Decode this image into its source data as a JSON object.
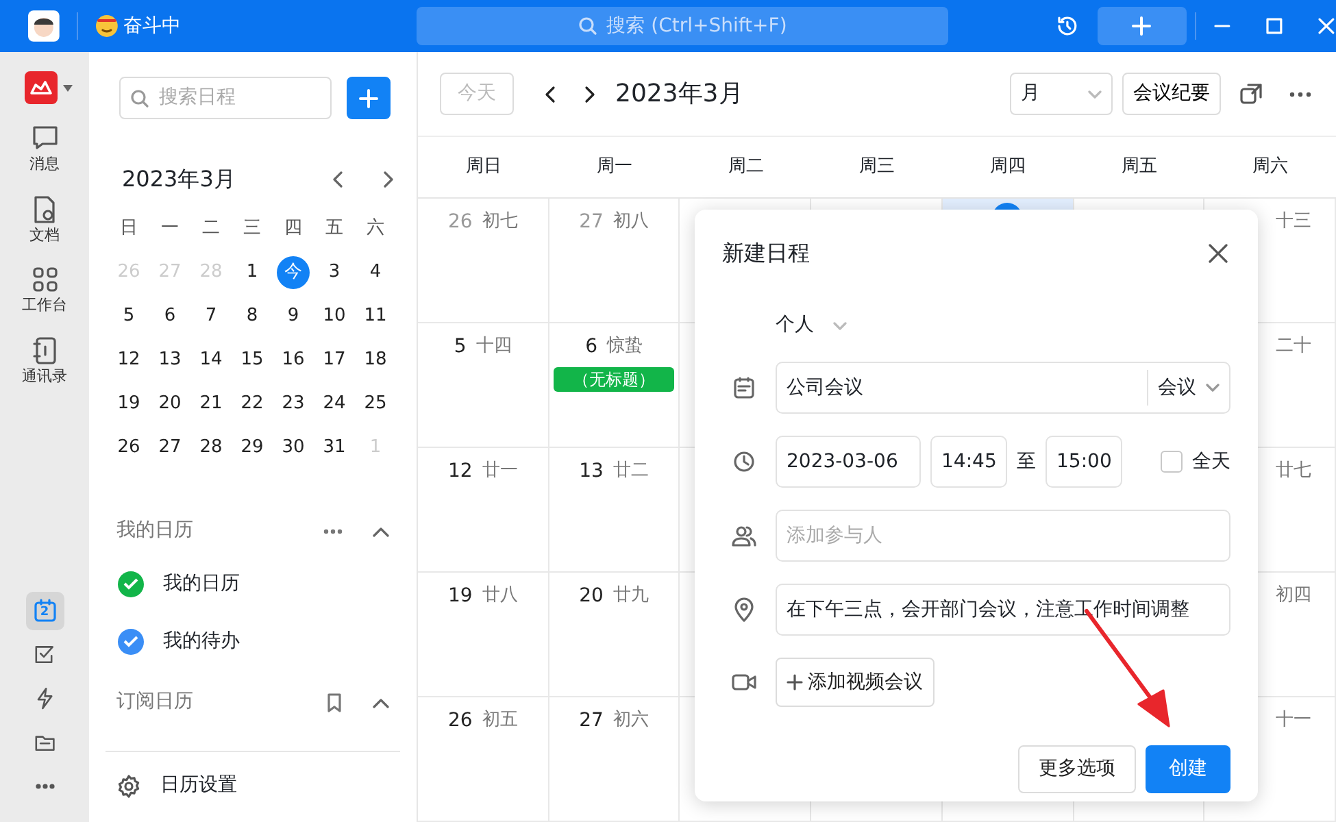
{
  "title_bar": {
    "status": "奋斗中",
    "search_placeholder": "搜索 (Ctrl+Shift+F)"
  },
  "rail": {
    "items": [
      {
        "kind": "chat",
        "label": "消息"
      },
      {
        "kind": "doc",
        "label": "文档"
      },
      {
        "kind": "grid",
        "label": "工作台"
      },
      {
        "kind": "contacts",
        "label": "通讯录"
      }
    ],
    "bottom": [
      {
        "kind": "calendar",
        "badge": "2",
        "selected": true
      },
      {
        "kind": "task",
        "selected": false
      },
      {
        "kind": "bolt",
        "selected": false
      },
      {
        "kind": "folder",
        "selected": false
      },
      {
        "kind": "more",
        "selected": false
      }
    ]
  },
  "sidebar": {
    "search_placeholder": "搜索日程",
    "mini_calendar": {
      "title": "2023年3月",
      "weekdays": [
        "日",
        "一",
        "二",
        "三",
        "四",
        "五",
        "六"
      ],
      "days": [
        {
          "label": "26",
          "outside": true,
          "today": false
        },
        {
          "label": "27",
          "outside": true,
          "today": false
        },
        {
          "label": "28",
          "outside": true,
          "today": false
        },
        {
          "label": "1",
          "outside": false,
          "today": false
        },
        {
          "label": "今",
          "outside": false,
          "today": true
        },
        {
          "label": "3",
          "outside": false,
          "today": false
        },
        {
          "label": "4",
          "outside": false,
          "today": false
        },
        {
          "label": "5",
          "outside": false,
          "today": false
        },
        {
          "label": "6",
          "outside": false,
          "today": false
        },
        {
          "label": "7",
          "outside": false,
          "today": false
        },
        {
          "label": "8",
          "outside": false,
          "today": false
        },
        {
          "label": "9",
          "outside": false,
          "today": false
        },
        {
          "label": "10",
          "outside": false,
          "today": false
        },
        {
          "label": "11",
          "outside": false,
          "today": false
        },
        {
          "label": "12",
          "outside": false,
          "today": false
        },
        {
          "label": "13",
          "outside": false,
          "today": false
        },
        {
          "label": "14",
          "outside": false,
          "today": false
        },
        {
          "label": "15",
          "outside": false,
          "today": false
        },
        {
          "label": "16",
          "outside": false,
          "today": false
        },
        {
          "label": "17",
          "outside": false,
          "today": false
        },
        {
          "label": "18",
          "outside": false,
          "today": false
        },
        {
          "label": "19",
          "outside": false,
          "today": false
        },
        {
          "label": "20",
          "outside": false,
          "today": false
        },
        {
          "label": "21",
          "outside": false,
          "today": false
        },
        {
          "label": "22",
          "outside": false,
          "today": false
        },
        {
          "label": "23",
          "outside": false,
          "today": false
        },
        {
          "label": "24",
          "outside": false,
          "today": false
        },
        {
          "label": "25",
          "outside": false,
          "today": false
        },
        {
          "label": "26",
          "outside": false,
          "today": false
        },
        {
          "label": "27",
          "outside": false,
          "today": false
        },
        {
          "label": "28",
          "outside": false,
          "today": false
        },
        {
          "label": "29",
          "outside": false,
          "today": false
        },
        {
          "label": "30",
          "outside": false,
          "today": false
        },
        {
          "label": "31",
          "outside": false,
          "today": false
        },
        {
          "label": "1",
          "outside": true,
          "today": false
        }
      ]
    },
    "sections": [
      {
        "title": "我的日历",
        "kind": "mine",
        "expanded": true,
        "items": [
          {
            "label": "我的日历",
            "color": "#12b549",
            "checked": true
          },
          {
            "label": "我的待办",
            "color": "#3a8ef6",
            "checked": true
          }
        ]
      },
      {
        "title": "订阅日历",
        "kind": "subscribe",
        "expanded": true
      }
    ],
    "settings": "日历设置"
  },
  "toolbar": {
    "today": "今天",
    "today_disabled": true,
    "title": "2023年3月",
    "view": "月",
    "minutes": "会议纪要"
  },
  "calendar": {
    "weekdays": [
      "周日",
      "周一",
      "周二",
      "周三",
      "周四",
      "周五",
      "周六"
    ],
    "weeks": [
      {
        "sun": {
          "day": "26",
          "lunar": "初七",
          "outside": true
        },
        "mon": {
          "day": "27",
          "lunar": "初八",
          "outside": true
        },
        "thu": {
          "today": true
        },
        "sat": {
          "lunar": "十三"
        }
      },
      {
        "sun": {
          "day": "5",
          "lunar": "十四",
          "outside": false
        },
        "mon": {
          "day": "6",
          "lunar": "惊蛰",
          "outside": false,
          "events": [
            {
              "title": "（无标题）",
              "color": "#12b549"
            }
          ]
        },
        "sat": {
          "lunar": "二十"
        }
      },
      {
        "sun": {
          "day": "12",
          "lunar": "廿一",
          "outside": false
        },
        "mon": {
          "day": "13",
          "lunar": "廿二",
          "outside": false
        },
        "sat": {
          "lunar": "廿七"
        }
      },
      {
        "sun": {
          "day": "19",
          "lunar": "廿八",
          "outside": false
        },
        "mon": {
          "day": "20",
          "lunar": "廿九",
          "outside": false
        },
        "sat": {
          "lunar": "初四"
        }
      },
      {
        "sun": {
          "day": "26",
          "lunar": "初五",
          "outside": false
        },
        "mon": {
          "day": "27",
          "lunar": "初六",
          "outside": false
        },
        "sat": {
          "lunar": "十一"
        }
      }
    ]
  },
  "dialog": {
    "title": "新建日程",
    "calendar": "个人",
    "event_title": "公司会议",
    "event_type": "会议",
    "date": "2023-03-06",
    "start": "14:45",
    "to": "至",
    "end": "15:00",
    "all_day_label": "全天",
    "all_day": false,
    "participants_placeholder": "添加参与人",
    "location": "在下午三点，会开部门会议，注意工作时间调整",
    "video": "添加视频会议",
    "more": "更多选项",
    "create": "创建"
  }
}
